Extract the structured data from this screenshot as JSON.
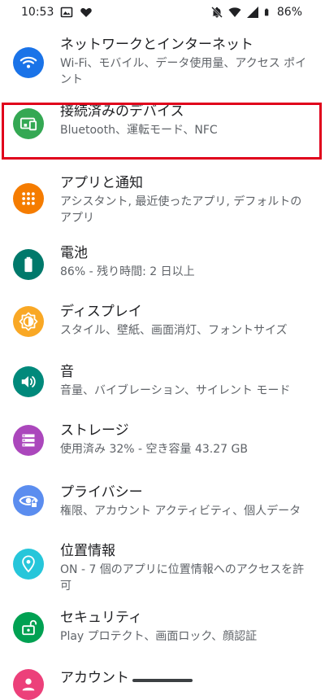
{
  "status_bar": {
    "time": "10:53",
    "battery": "86%"
  },
  "settings": [
    {
      "title": "ネットワークとインターネット",
      "subtitle": "Wi-Fi、モバイル、データ使用量、アクセス ポイント",
      "color": "#1a73e8",
      "icon": "wifi-icon"
    },
    {
      "title": "接続済みのデバイス",
      "subtitle": "Bluetooth、運転モード、NFC",
      "color": "#34a853",
      "icon": "devices-icon"
    },
    {
      "title": "アプリと通知",
      "subtitle": "アシスタント, 最近使ったアプリ, デフォルトのアプリ",
      "color": "#f57c00",
      "icon": "apps-grid-icon"
    },
    {
      "title": "電池",
      "subtitle": "86% - 残り時間: 2 日以上",
      "color": "#00796b",
      "icon": "battery-icon"
    },
    {
      "title": "ディスプレイ",
      "subtitle": "スタイル、壁紙、画面消灯、フォントサイズ",
      "color": "#f9a825",
      "icon": "brightness-icon"
    },
    {
      "title": "音",
      "subtitle": "音量、バイブレーション、サイレント モード",
      "color": "#00897b",
      "icon": "volume-icon"
    },
    {
      "title": "ストレージ",
      "subtitle": "使用済み 32% - 空き容量 43.27 GB",
      "color": "#ab47bc",
      "icon": "storage-icon"
    },
    {
      "title": "プライバシー",
      "subtitle": "権限、アカウント アクティビティ、個人データ",
      "color": "#5b8def",
      "icon": "privacy-eye-icon"
    },
    {
      "title": "位置情報",
      "subtitle": "ON - 7 個のアプリに位置情報へのアクセスを許可",
      "color": "#26c6da",
      "icon": "location-icon"
    },
    {
      "title": "セキュリティ",
      "subtitle": "Play プロテクト、画面ロック、顔認証",
      "color": "#00a152",
      "icon": "lock-open-icon"
    },
    {
      "title": "アカウント",
      "subtitle": "",
      "color": "#ec407a",
      "icon": "account-icon"
    }
  ]
}
